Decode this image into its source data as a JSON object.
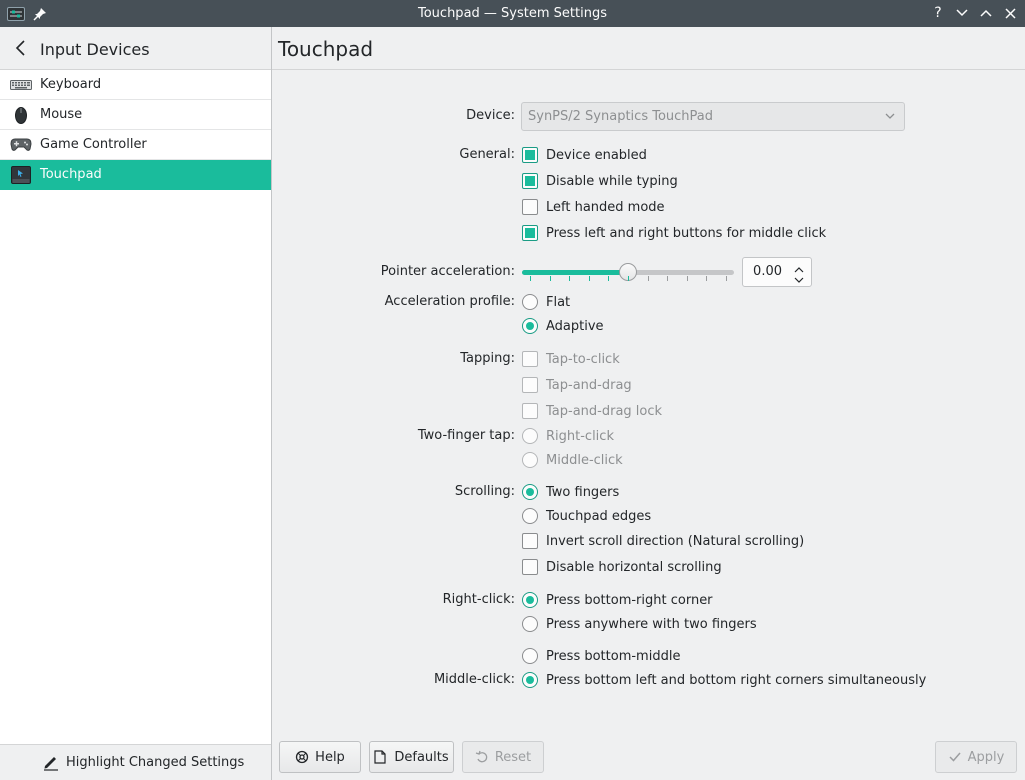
{
  "window": {
    "title": "Touchpad — System Settings"
  },
  "colors": {
    "accent": "#1abc9c",
    "titlebar": "#475057"
  },
  "sidebar": {
    "header": "Input Devices",
    "items": [
      {
        "label": "Keyboard",
        "icon": "keyboard-icon"
      },
      {
        "label": "Mouse",
        "icon": "mouse-icon"
      },
      {
        "label": "Game Controller",
        "icon": "gamepad-icon"
      },
      {
        "label": "Touchpad",
        "icon": "touchpad-icon",
        "active": true
      }
    ],
    "footer": "Highlight Changed Settings"
  },
  "page": {
    "title": "Touchpad",
    "device_label": "Device:",
    "device_value": "SynPS/2 Synaptics TouchPad",
    "general": {
      "label": "General:",
      "options": [
        {
          "text": "Device enabled",
          "checked": true
        },
        {
          "text": "Disable while typing",
          "checked": true
        },
        {
          "text": "Left handed mode",
          "checked": false
        },
        {
          "text": "Press left and right buttons for middle click",
          "checked": true
        }
      ]
    },
    "pointer_acceleration": {
      "label": "Pointer acceleration:",
      "value": "0.00",
      "slider_fraction": 0.5
    },
    "acceleration_profile": {
      "label": "Acceleration profile:",
      "options": [
        "Flat",
        "Adaptive"
      ],
      "selected": "Adaptive"
    },
    "tapping": {
      "label": "Tapping:",
      "options": [
        "Tap-to-click",
        "Tap-and-drag",
        "Tap-and-drag lock"
      ]
    },
    "two_finger_tap": {
      "label": "Two-finger tap:",
      "options": [
        "Right-click",
        "Middle-click"
      ]
    },
    "scrolling": {
      "label": "Scrolling:",
      "radios": [
        "Two fingers",
        "Touchpad edges"
      ],
      "selected": "Two fingers",
      "checks": [
        "Invert scroll direction (Natural scrolling)",
        "Disable horizontal scrolling"
      ]
    },
    "right_click": {
      "label": "Right-click:",
      "options": [
        "Press bottom-right corner",
        "Press anywhere with two fingers"
      ],
      "selected": "Press bottom-right corner"
    },
    "middle_click": {
      "label": "Middle-click:",
      "options": [
        "Press bottom-middle",
        "Press bottom left and bottom right corners simultaneously"
      ],
      "selected": "Press bottom left and bottom right corners simultaneously"
    }
  },
  "buttons": {
    "help": "Help",
    "defaults": "Defaults",
    "reset": "Reset",
    "apply": "Apply"
  }
}
